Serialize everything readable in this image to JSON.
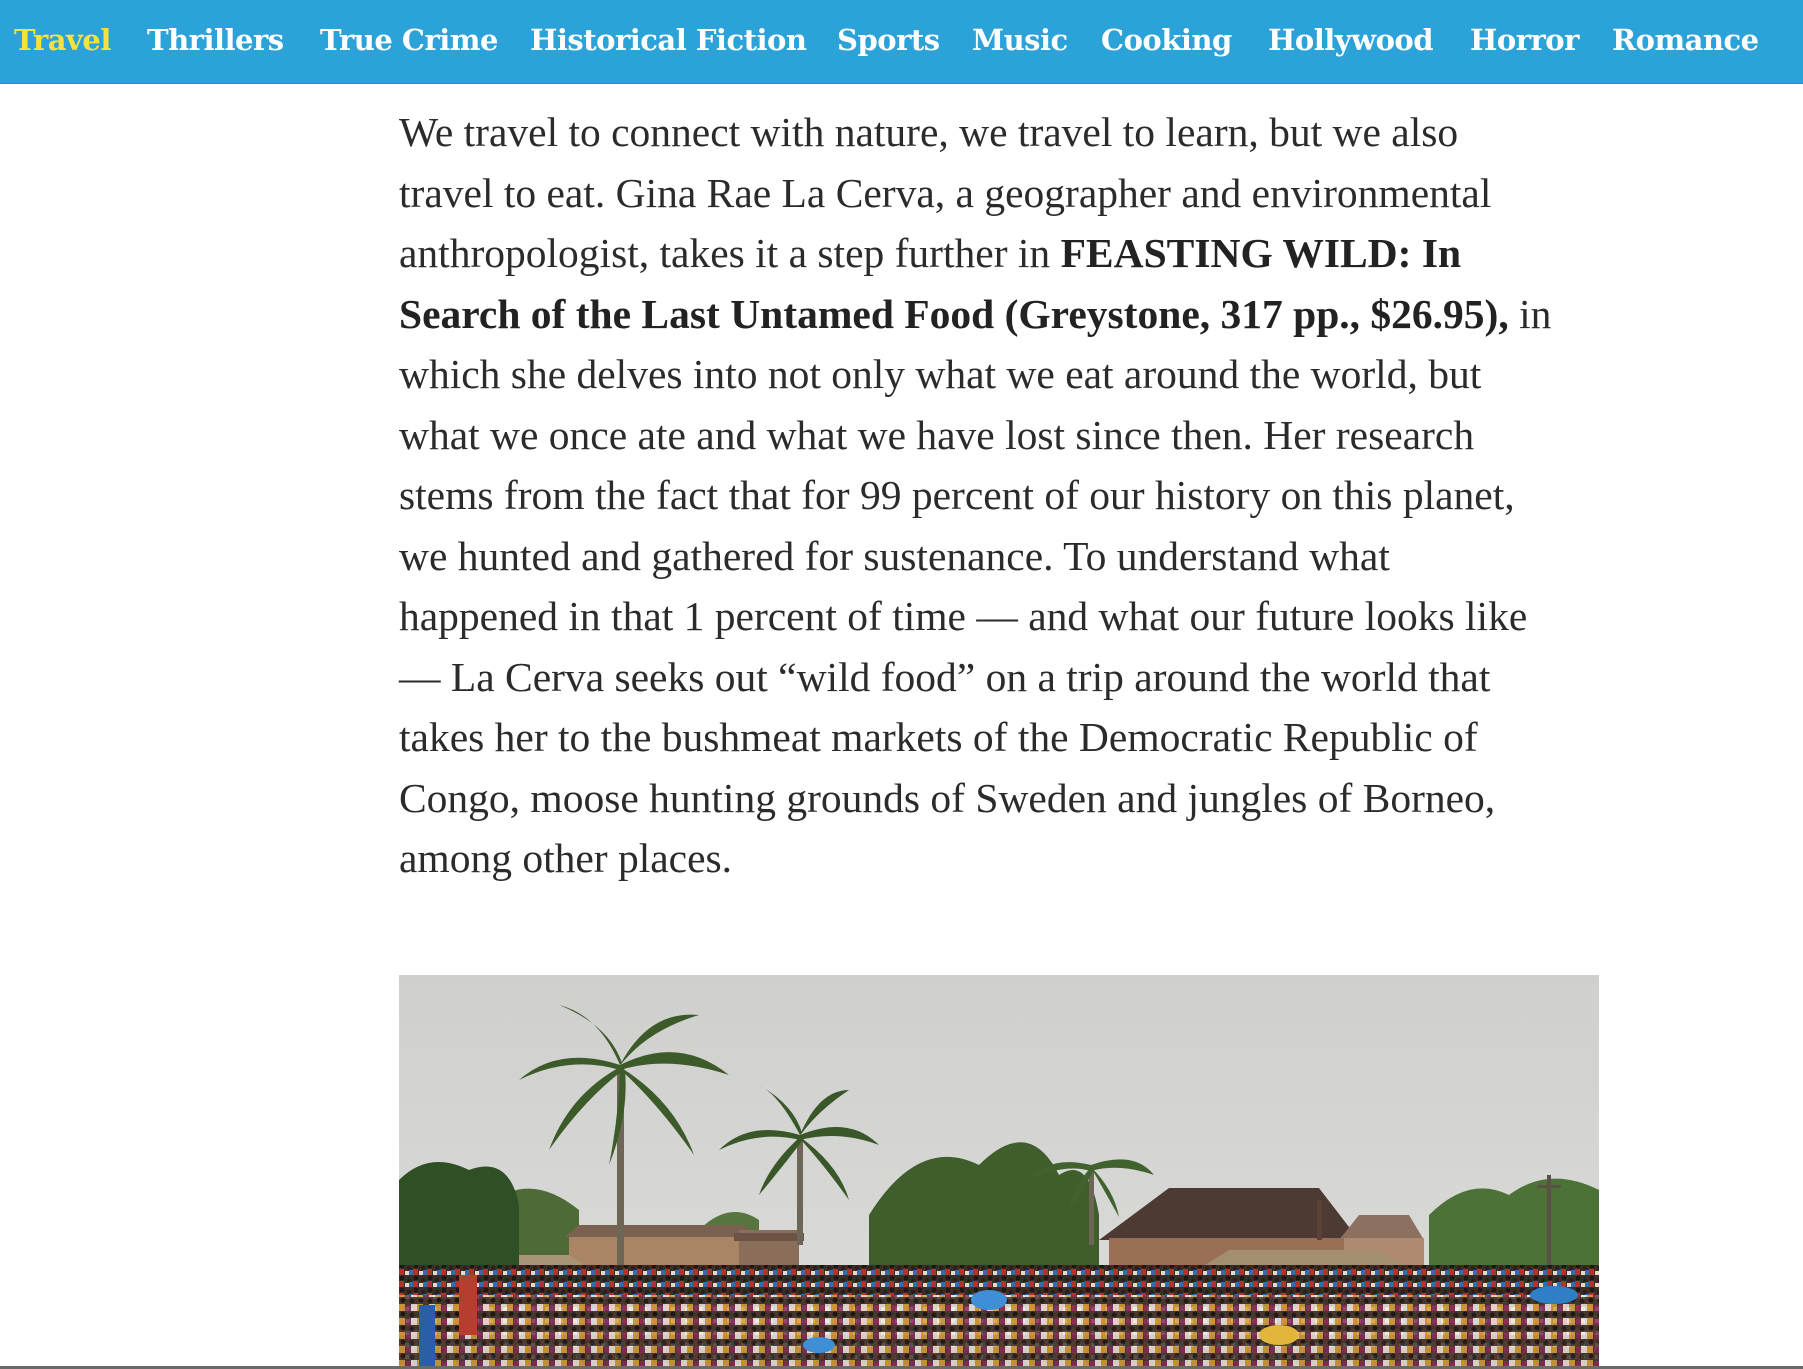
{
  "nav": {
    "items": [
      {
        "label": "Travel",
        "active": true
      },
      {
        "label": "Thrillers",
        "active": false
      },
      {
        "label": "True Crime",
        "active": false
      },
      {
        "label": "Historical Fiction",
        "active": false
      },
      {
        "label": "Sports",
        "active": false
      },
      {
        "label": "Music",
        "active": false
      },
      {
        "label": "Cooking",
        "active": false
      },
      {
        "label": "Hollywood",
        "active": false
      },
      {
        "label": "Horror",
        "active": false
      },
      {
        "label": "Romance",
        "active": false
      }
    ],
    "colors": {
      "background": "#2ba2d8",
      "text": "#ffffff",
      "active_text": "#f5e23c"
    }
  },
  "article": {
    "lines": [
      {
        "text": "We travel to connect with nature, we travel to learn, but we also"
      },
      {
        "text": "travel to eat. Gina Rae La Cerva, a geographer and environmental"
      },
      {
        "text": "anthropologist, takes it a step further in ",
        "bold": "FEASTING WILD: In"
      },
      {
        "bold": "Search of the Last Untamed Food (Greystone, 317 pp., $26.95),",
        "after": " in"
      },
      {
        "text": "which she delves into not only what we eat around the world, but"
      },
      {
        "text": "what we once ate and what we have lost since then. Her research"
      },
      {
        "text": "stems from the fact that for 99 percent of our history on this planet,"
      },
      {
        "text": "we hunted and gathered for sustenance. To understand what"
      },
      {
        "text": "happened in that 1 percent of time — and what our future looks like"
      },
      {
        "text": "— La Cerva seeks out “wild food” on a trip around the world that"
      },
      {
        "text": "takes her to the bushmeat markets of the Democratic Republic of"
      },
      {
        "text": "Congo, moose hunting grounds of Sweden and jungles of Borneo,"
      },
      {
        "text": "among other places."
      }
    ]
  },
  "photo": {
    "subject": "crowded outdoor bushmeat market with palm trees and brick buildings under an overcast sky"
  }
}
